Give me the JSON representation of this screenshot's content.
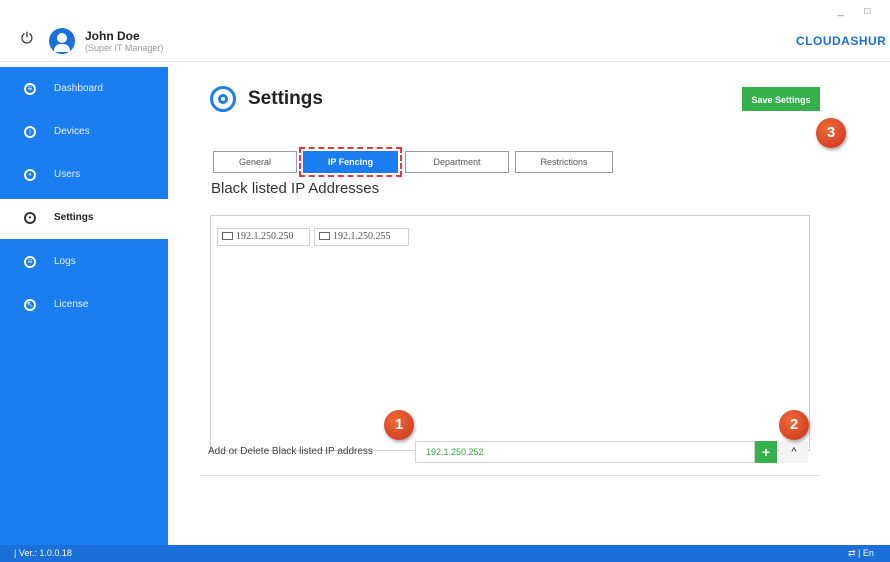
{
  "user": {
    "name": "John Doe",
    "role": "(Super IT Manager)"
  },
  "brand": "CLOUDASHUR",
  "window_controls": "_ □ X",
  "sidebar": {
    "items": [
      {
        "label": "Dashboard",
        "icon": "dashboard-icon",
        "active": false
      },
      {
        "label": "Devices",
        "icon": "devices-icon",
        "active": false
      },
      {
        "label": "Users",
        "icon": "users-icon",
        "active": false
      },
      {
        "label": "Settings",
        "icon": "settings-icon",
        "active": true
      },
      {
        "label": "Logs",
        "icon": "logs-icon",
        "active": false
      },
      {
        "label": "License",
        "icon": "license-icon",
        "active": false
      }
    ]
  },
  "status": {
    "version": "| Ver.: 1.0.0.18",
    "lang": "⇄ | En"
  },
  "page": {
    "title": "Settings",
    "icon": "gear-icon"
  },
  "actions": {
    "save_label": "Save Settings"
  },
  "tabs": [
    {
      "label": "General",
      "active": false
    },
    {
      "label": "IP Fencing",
      "active": true
    },
    {
      "label": "Department",
      "active": false
    },
    {
      "label": "Restrictions",
      "active": false
    }
  ],
  "blacklist": {
    "title": "Black listed IP Addresses",
    "entries": [
      "192.1.250.250",
      "192.1.250.255"
    ],
    "add_label": "Add or Delete Black listed IP address",
    "input_value": "192.1.250.252",
    "add_button": "+",
    "collapse_button": "^"
  },
  "callouts": [
    "1",
    "2",
    "3"
  ],
  "colors": {
    "accent": "#1a7df0",
    "save": "#35b04a",
    "callout": "#d9442a"
  }
}
